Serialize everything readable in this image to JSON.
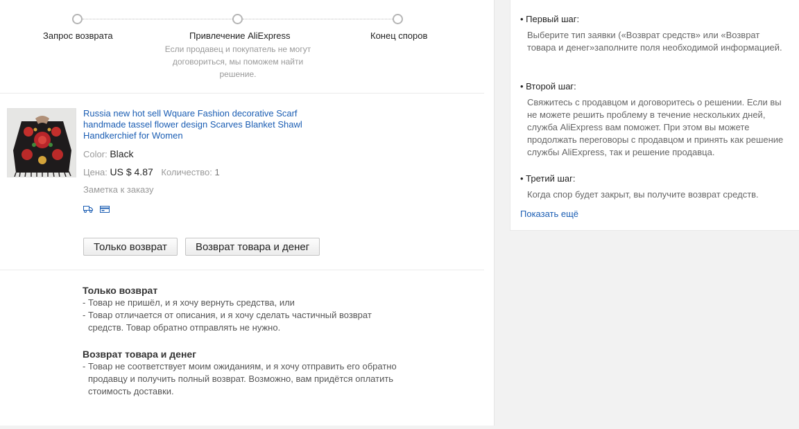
{
  "progress": {
    "steps": [
      {
        "label": "Запрос возврата",
        "desc": ""
      },
      {
        "label": "Привлечение AliExpress",
        "desc": "Если продавец и покупатель не могут договориться, мы поможем найти решение."
      },
      {
        "label": "Конец споров",
        "desc": ""
      }
    ]
  },
  "product": {
    "title": "Russia new hot sell Wquare Fashion decorative Scarf handmade tassel flower design Scarves Blanket Shawl Handkerchief for Women",
    "color_label": "Color:",
    "color_value": "Black",
    "price_label": "Цена:",
    "price_value": "US $ 4.87",
    "qty_label": "Количество:",
    "qty_value": "1",
    "note": "Заметка к заказу",
    "icons": [
      "truck-icon",
      "card-icon"
    ]
  },
  "actions": {
    "refund_only": "Только возврат",
    "return_and_refund": "Возврат товара и денег"
  },
  "explanations": {
    "refund_only": {
      "title": "Только возврат",
      "lines": [
        "- Товар не пришёл, и я хочу вернуть средства, или",
        "- Товар отличается от описания, и я хочу сделать частичный возврат средств. Товар обратно отправлять не нужно."
      ]
    },
    "return_and_refund": {
      "title": "Возврат товара и денег",
      "lines": [
        "- Товар не соответствует моим ожиданиям, и я хочу отправить его обратно продавцу и получить полный возврат. Возможно, вам придётся оплатить стоимость доставки."
      ]
    }
  },
  "side": {
    "steps": [
      {
        "title": "• Первый шаг:",
        "body": "Выберите тип заявки («Возврат средств» или «Возврат товара и денег»заполните поля необходимой информацией."
      },
      {
        "title": "• Второй шаг:",
        "body": "Свяжитесь с продавцом и договоритесь о решении. Если вы не можете решить проблему в течение нескольких дней, служба AliExpress вам поможет. При этом вы можете продолжать переговоры с продавцом и принять как решение службы AliExpress, так и решение продавца."
      },
      {
        "title": "• Третий шаг:",
        "body": "Когда спор будет закрыт, вы получите возврат средств."
      }
    ],
    "show_more": "Показать ещё"
  },
  "colors": {
    "link": "#1a5db3",
    "muted": "#999999",
    "border": "#ebebeb"
  }
}
